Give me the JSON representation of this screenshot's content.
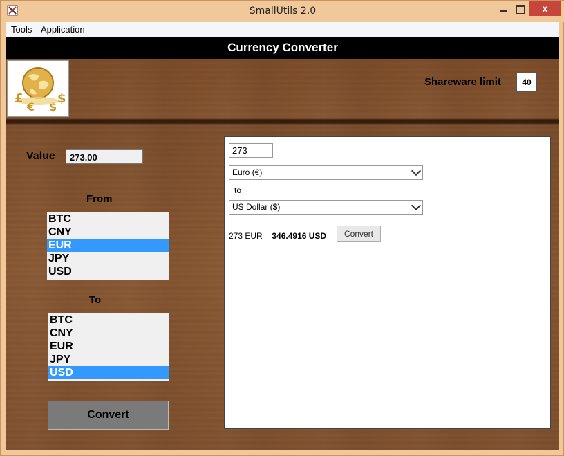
{
  "window": {
    "title": "SmallUtils 2.0",
    "close_glyph": "x"
  },
  "menu": {
    "items": [
      "Tools",
      "Application"
    ]
  },
  "header": {
    "title": "Currency Converter"
  },
  "logo": {
    "icon": "globe-currency-icon"
  },
  "shareware": {
    "label": "Shareware limit",
    "value": "40"
  },
  "value": {
    "label": "Value",
    "amount": "273.00"
  },
  "from": {
    "label": "From",
    "currencies": [
      "BTC",
      "CNY",
      "EUR",
      "JPY",
      "USD"
    ],
    "selected": "EUR"
  },
  "to": {
    "label": "To",
    "currencies": [
      "BTC",
      "CNY",
      "EUR",
      "JPY",
      "USD"
    ],
    "selected": "USD"
  },
  "convert_button": {
    "label": "Convert"
  },
  "web_panel": {
    "amount": "273",
    "from_currency": "Euro (€)",
    "to_text": "to",
    "to_currency": "US Dollar ($)",
    "result_prefix": "273 EUR = ",
    "result_value": "346.4916 USD",
    "convert_label": "Convert"
  },
  "colors": {
    "selection": "#3399ff",
    "header_bg": "#000000",
    "close_btn": "#c7463b"
  }
}
